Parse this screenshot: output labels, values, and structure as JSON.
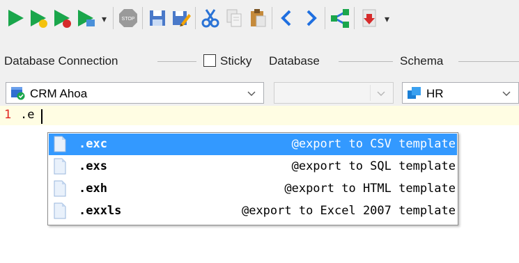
{
  "toolbar": {
    "buttons": [
      {
        "name": "execute-icon",
        "dropdown": false
      },
      {
        "name": "execute-script-icon",
        "dropdown": false
      },
      {
        "name": "execute-current-icon",
        "dropdown": false
      },
      {
        "name": "execute-explain-icon",
        "dropdown": true
      },
      {
        "name": "stop-icon",
        "label": "STOP"
      },
      {
        "name": "save-icon"
      },
      {
        "name": "save-as-icon"
      },
      {
        "name": "cut-icon"
      },
      {
        "name": "copy-icon"
      },
      {
        "name": "paste-icon"
      },
      {
        "name": "back-icon"
      },
      {
        "name": "forward-icon"
      },
      {
        "name": "share-icon"
      },
      {
        "name": "import-icon",
        "dropdown": true
      }
    ],
    "stop_label": "STOP",
    "dropdown_glyph": "▾"
  },
  "labels": {
    "database_connection": "Database Connection",
    "sticky": "Sticky",
    "database": "Database",
    "schema": "Schema"
  },
  "connection": {
    "value": "CRM Ahoa",
    "icon": "database-connection-icon"
  },
  "database": {
    "value": ""
  },
  "schema": {
    "value": "HR",
    "icon": "schema-icon"
  },
  "editor": {
    "line_number": "1",
    "text": ".e"
  },
  "autocomplete": {
    "items": [
      {
        "key": ".exc",
        "description": "@export to CSV template",
        "selected": true
      },
      {
        "key": ".exs",
        "description": "@export to SQL template",
        "selected": false
      },
      {
        "key": ".exh",
        "description": "@export to HTML template",
        "selected": false
      },
      {
        "key": ".exxls",
        "description": "@export to Excel 2007 template",
        "selected": false
      }
    ]
  },
  "colors": {
    "selection": "#3399ff",
    "current_line": "#fffde3",
    "play_green": "#1aa64b",
    "line_number_red": "#e0241e"
  }
}
